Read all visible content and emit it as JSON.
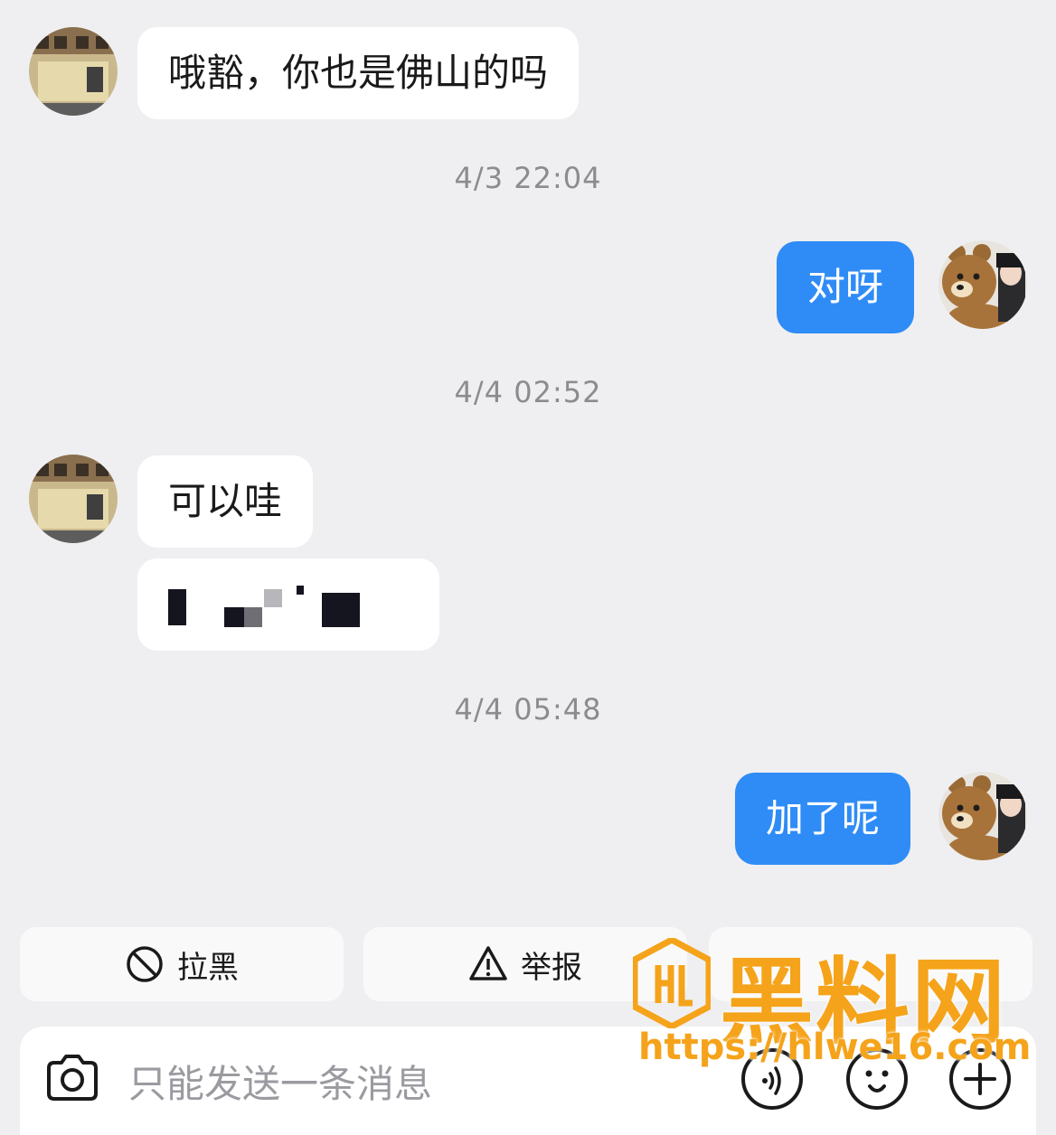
{
  "messages": [
    {
      "side": "in",
      "text": "哦豁，你也是佛山的吗"
    },
    {
      "timestamp": "4/3 22:04"
    },
    {
      "side": "out",
      "text": "对呀"
    },
    {
      "timestamp": "4/4 02:52"
    },
    {
      "side": "in",
      "text": "可以哇"
    },
    {
      "side": "in",
      "redacted": true
    },
    {
      "timestamp": "4/4 05:48"
    },
    {
      "side": "out",
      "text": "加了呢"
    }
  ],
  "actions": {
    "block_label": "拉黑",
    "report_label": "举报",
    "third_label": ""
  },
  "input": {
    "placeholder": "只能发送一条消息"
  },
  "watermark": {
    "title": "黑料网",
    "url": "https://hlwe16.com"
  },
  "colors": {
    "background": "#efeff1",
    "outgoing_bubble": "#2f8cf6",
    "incoming_bubble": "#ffffff",
    "watermark": "#f5a31a"
  },
  "icons": {
    "block": "prohibited-icon",
    "report": "warning-triangle-icon",
    "camera": "camera-icon",
    "voice": "voice-icon",
    "emoji": "emoji-icon",
    "add": "plus-icon"
  }
}
